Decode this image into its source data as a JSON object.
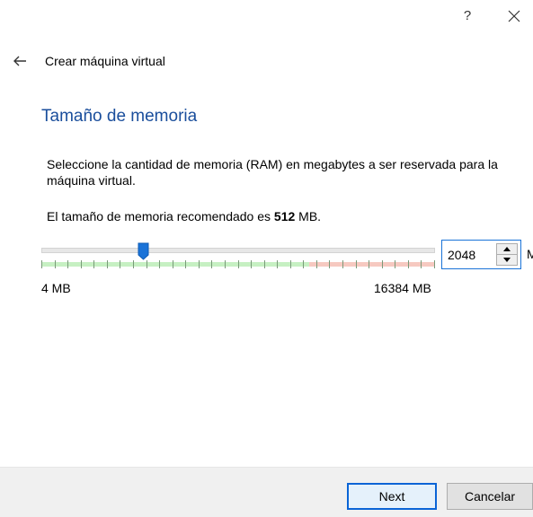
{
  "window": {
    "help_label": "?",
    "title": "Crear máquina virtual"
  },
  "icons": {
    "back": "arrow-left-icon",
    "close": "close-icon",
    "spin_up": "triangle-up-icon",
    "spin_down": "triangle-down-icon",
    "slider_handle": "slider-handle-icon"
  },
  "page": {
    "heading": "Tamaño de memoria",
    "description": "Seleccione la cantidad de memoria (RAM) en megabytes a ser reservada para la máquina virtual.",
    "recommend_prefix": "El tamaño de memoria recomendado es ",
    "recommend_value": "512",
    "recommend_suffix": " MB."
  },
  "memory": {
    "min": 4,
    "max": 16384,
    "current": 2048,
    "recommended": 512,
    "min_label": "4 MB",
    "max_label": "16384 MB",
    "value_text": "2048",
    "unit": "MB",
    "safe_fraction": 0.68
  },
  "colors": {
    "accent": "#1a73d8",
    "heading": "#1a4e9c",
    "safe_zone": "#c6f0c2",
    "danger_zone": "#f6c9c0"
  },
  "buttons": {
    "next": "Next",
    "cancel": "Cancelar"
  }
}
